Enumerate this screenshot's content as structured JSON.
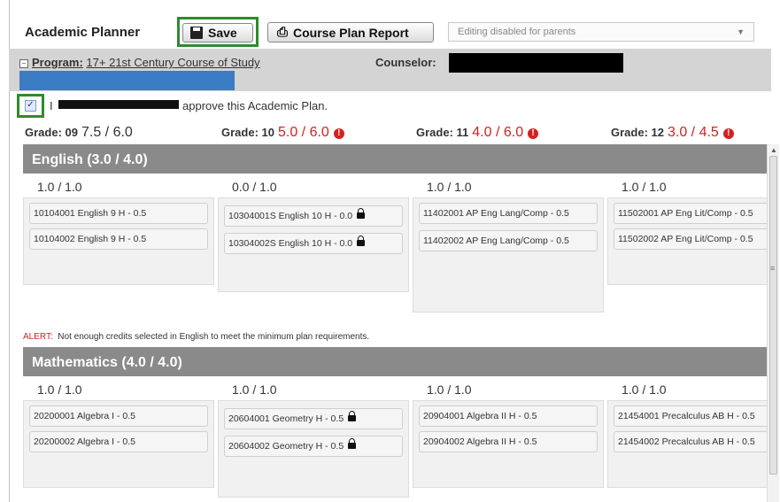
{
  "toolbar": {
    "title": "Academic Planner",
    "save_label": "Save",
    "report_label": "Course Plan Report",
    "status_select": "Editing disabled for parents"
  },
  "program": {
    "label": "Program:",
    "value": "17+ 21st Century Course of Study",
    "counselor_label": "Counselor:"
  },
  "approval": {
    "prefix": "I",
    "text": "approve this Academic Plan.",
    "checked": true
  },
  "grades": [
    {
      "label": "Grade: 09",
      "value": "7.5 / 6.0",
      "warning": false
    },
    {
      "label": "Grade: 10",
      "value": "5.0 / 6.0",
      "warning": true
    },
    {
      "label": "Grade: 11",
      "value": "4.0 / 6.0",
      "warning": true
    },
    {
      "label": "Grade: 12",
      "value": "3.0 / 4.5",
      "warning": true
    }
  ],
  "subjects": [
    {
      "title": "English (3.0 / 4.0)",
      "columns": [
        {
          "credits": "1.0 / 1.0",
          "courses": [
            "10104001 English 9 H - 0.5",
            "10104002 English 9 H - 0.5"
          ],
          "locked": false
        },
        {
          "credits": "0.0 / 1.0",
          "courses": [
            "10304001S English 10 H - 0.0",
            "10304002S English 10 H - 0.0"
          ],
          "locked": true
        },
        {
          "credits": "1.0 / 1.0",
          "courses": [
            "11402001 AP Eng Lang/Comp - 0.5",
            "11402002 AP Eng Lang/Comp - 0.5"
          ],
          "locked": false
        },
        {
          "credits": "1.0 / 1.0",
          "courses": [
            "11502001 AP Eng Lit/Comp - 0.5",
            "11502002 AP Eng Lit/Comp - 0.5"
          ],
          "locked": false
        }
      ],
      "alert_prefix": "ALERT:",
      "alert_text": "Not enough credits selected in English to meet the minimum plan requirements."
    },
    {
      "title": "Mathematics (4.0 / 4.0)",
      "columns": [
        {
          "credits": "1.0 / 1.0",
          "courses": [
            "20200001 Algebra I - 0.5",
            "20200002 Algebra I - 0.5"
          ],
          "locked": false
        },
        {
          "credits": "1.0 / 1.0",
          "courses": [
            "20604001 Geometry H - 0.5",
            "20604002 Geometry H - 0.5"
          ],
          "locked": true
        },
        {
          "credits": "1.0 / 1.0",
          "courses": [
            "20904001 Algebra II H - 0.5",
            "20904002 Algebra II H - 0.5"
          ],
          "locked": false
        },
        {
          "credits": "1.0 / 1.0",
          "courses": [
            "21454001 Precalculus AB H - 0.5",
            "21454002 Precalculus AB H - 0.5"
          ],
          "locked": false
        }
      ]
    }
  ],
  "colors": {
    "accent_green": "#2e8b2e",
    "header_gray": "#8a8a8a",
    "warning_red": "#d42020",
    "program_blue": "#3b7cc4"
  },
  "icons": {
    "save": "floppy-disk-icon",
    "report": "printer-icon",
    "warning": "exclamation-circle-icon",
    "lock": "lock-icon"
  }
}
